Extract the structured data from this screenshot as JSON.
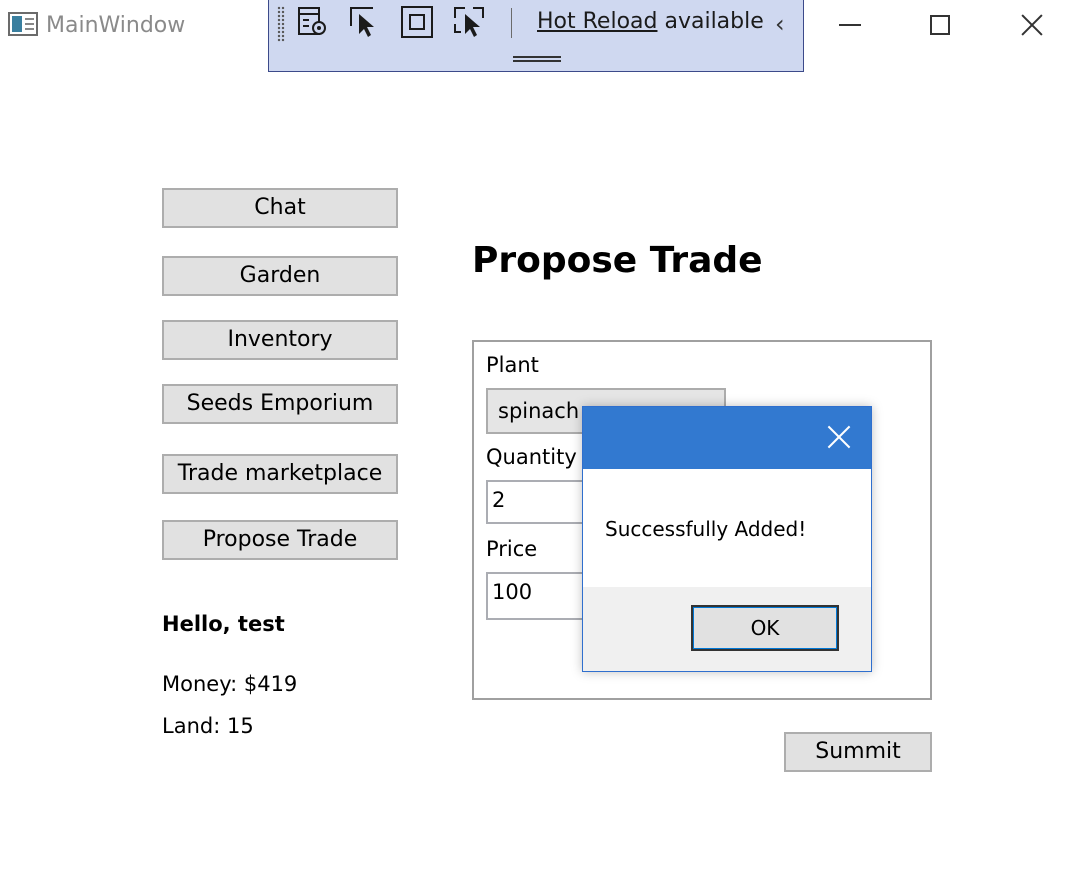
{
  "window": {
    "title": "MainWindow",
    "icon": "window-app-icon"
  },
  "debug_toolbar": {
    "hot_reload_link": "Hot Reload",
    "hot_reload_suffix": " available",
    "collapse_glyph": "‹",
    "icons": [
      "live-visual-tree-icon",
      "select-element-icon",
      "display-layout-adorners-icon",
      "track-focused-element-icon"
    ]
  },
  "nav": {
    "chat": "Chat",
    "garden": "Garden",
    "inventory": "Inventory",
    "seeds_emporium": "Seeds Emporium",
    "trade_marketplace": "Trade marketplace",
    "propose_trade": "Propose Trade"
  },
  "user": {
    "greeting": "Hello, test",
    "money": "Money: $419",
    "land": "Land: 15"
  },
  "page": {
    "title": "Propose Trade"
  },
  "form": {
    "plant_label": "Plant",
    "plant_value": "spinach",
    "quantity_label": "Quantity",
    "quantity_value": "2",
    "price_label": "Price",
    "price_value": "100",
    "submit_label": "Summit"
  },
  "dialog": {
    "message": "Successfully Added!",
    "ok_label": "OK",
    "header_color": "#3279d0"
  }
}
